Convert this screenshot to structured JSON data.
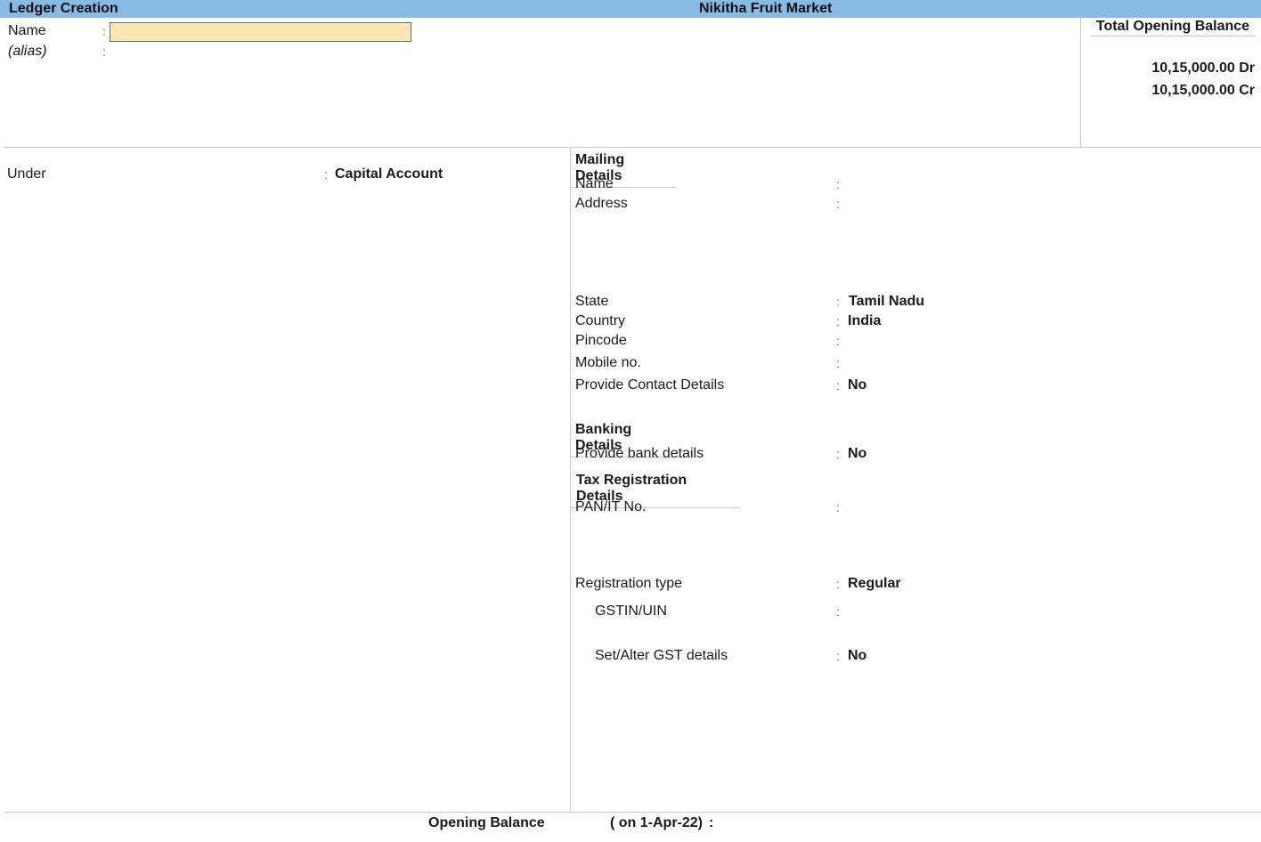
{
  "header": {
    "screen_title": "Ledger Creation",
    "company_name": "Nikitha Fruit Market"
  },
  "form": {
    "name": {
      "label": "Name",
      "value": ""
    },
    "alias": {
      "label": "(alias)",
      "value": ""
    },
    "under": {
      "label": "Under",
      "value": "Capital Account"
    }
  },
  "total_opening_balance": {
    "title": "Total Opening Balance",
    "debit": "10,15,000.00 Dr",
    "credit": "10,15,000.00 Cr"
  },
  "mailing_details": {
    "heading": "Mailing Details",
    "fields": {
      "name": {
        "label": "Name",
        "value": ""
      },
      "address": {
        "label": "Address",
        "value": ""
      },
      "state": {
        "label": "State",
        "value": "Tamil Nadu"
      },
      "country": {
        "label": "Country",
        "value": "India"
      },
      "pincode": {
        "label": "Pincode",
        "value": ""
      },
      "mobile": {
        "label": "Mobile no.",
        "value": ""
      },
      "contact_details": {
        "label": "Provide Contact Details",
        "value": "No"
      }
    }
  },
  "banking_details": {
    "heading": "Banking Details",
    "provide_bank": {
      "label": "Provide bank details",
      "value": "No"
    }
  },
  "tax_registration": {
    "heading": "Tax Registration Details",
    "pan": {
      "label": "PAN/IT No.",
      "value": ""
    },
    "registration_type": {
      "label": "Registration type",
      "value": "Regular"
    },
    "gstin": {
      "label": "GSTIN/UIN",
      "value": ""
    },
    "gst_details": {
      "label": "Set/Alter GST details",
      "value": "No"
    }
  },
  "footer": {
    "opening_balance_label": "Opening Balance",
    "opening_balance_date": "( on 1-Apr-22)",
    "colon": ":"
  },
  "colon": ":",
  "colors": {
    "titlebar": "#88bbe4",
    "active_input": "#fde6b4",
    "input_border": "#3a7d86"
  }
}
